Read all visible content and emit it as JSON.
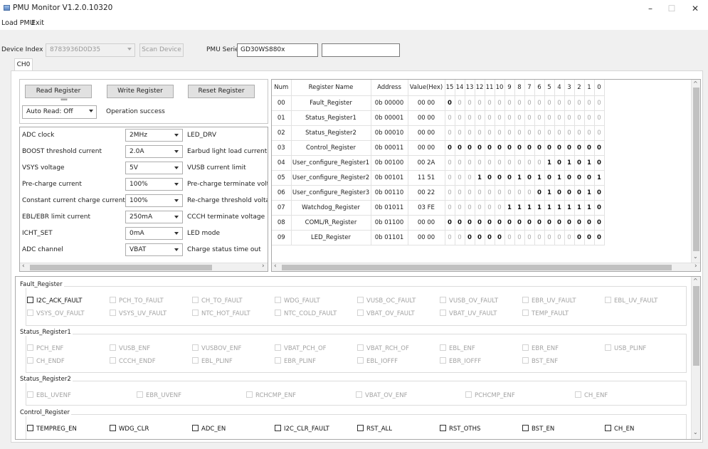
{
  "window": {
    "title": "PMU Monitor V1.2.0.10320",
    "min_glyph": "–",
    "max_glyph": "☐",
    "close_glyph": "✕"
  },
  "menu": [
    "Load PMU",
    "Exit"
  ],
  "toolbar": {
    "device_index_label": "Device Index",
    "device_index_value": "8783936D0D35",
    "scan_device": "Scan Device",
    "pmu_series_label": "PMU Series",
    "pmu_series_value": "GD30WS880x",
    "extra_value": ""
  },
  "tab": "CH0",
  "controls": {
    "read_register": "Read Register",
    "write_register": "Write Register",
    "reset_register": "Reset Register",
    "indicator": "***",
    "auto_read": "Auto Read: Off",
    "status": "Operation success"
  },
  "params": [
    {
      "name": "ADC clock",
      "value": "2MHz",
      "right": "LED_DRV"
    },
    {
      "name": "BOOST threshold current",
      "value": "2.0A",
      "right": "Earbud light load current"
    },
    {
      "name": "VSYS voltage",
      "value": "5V",
      "right": "VUSB current limit"
    },
    {
      "name": "Pre-charge current",
      "value": "100%",
      "right": "Pre-charge terminate volta"
    },
    {
      "name": "Constant current charge current",
      "value": "100%",
      "right": "Re-charge threshold voltag"
    },
    {
      "name": "EBL/EBR limit current",
      "value": "250mA",
      "right": "CCCH terminate voltage"
    },
    {
      "name": "ICHT_SET",
      "value": "0mA",
      "right": "LED mode"
    },
    {
      "name": "ADC channel",
      "value": "VBAT",
      "right": "Charge status time out"
    }
  ],
  "scroll_glyphs": {
    "left": "‹",
    "right": "›",
    "up": "^",
    "down": "⌄"
  },
  "table": {
    "headers": [
      "Num",
      "Register Name",
      "Address",
      "Value(Hex)",
      "15",
      "14",
      "13",
      "12",
      "11",
      "10",
      "9",
      "8",
      "7",
      "6",
      "5",
      "4",
      "3",
      "2",
      "1",
      "0"
    ],
    "rows": [
      {
        "num": "00",
        "name": "Fault_Register",
        "addr": "0b 00000",
        "hex": "00 00",
        "bits": [
          "0",
          "0",
          "0",
          "0",
          "0",
          "0",
          "0",
          "0",
          "0",
          "0",
          "0",
          "0",
          "0",
          "0",
          "0",
          "0"
        ],
        "strong": [
          0
        ]
      },
      {
        "num": "01",
        "name": "Status_Register1",
        "addr": "0b 00001",
        "hex": "00 00",
        "bits": [
          "0",
          "0",
          "0",
          "0",
          "0",
          "0",
          "0",
          "0",
          "0",
          "0",
          "0",
          "0",
          "0",
          "0",
          "0",
          "0"
        ],
        "strong": []
      },
      {
        "num": "02",
        "name": "Status_Register2",
        "addr": "0b 00010",
        "hex": "00 00",
        "bits": [
          "0",
          "0",
          "0",
          "0",
          "0",
          "0",
          "0",
          "0",
          "0",
          "0",
          "0",
          "0",
          "0",
          "0",
          "0",
          "0"
        ],
        "strong": []
      },
      {
        "num": "03",
        "name": "Control_Register",
        "addr": "0b 00011",
        "hex": "00 00",
        "bits": [
          "0",
          "0",
          "0",
          "0",
          "0",
          "0",
          "0",
          "0",
          "0",
          "0",
          "0",
          "0",
          "0",
          "0",
          "0",
          "0"
        ],
        "strong": [
          0,
          1,
          2,
          3,
          4,
          5,
          6,
          7,
          8,
          9,
          10,
          11,
          12,
          13,
          14,
          15
        ]
      },
      {
        "num": "04",
        "name": "User_configure_Register1",
        "addr": "0b 00100",
        "hex": "00 2A",
        "bits": [
          "0",
          "0",
          "0",
          "0",
          "0",
          "0",
          "0",
          "0",
          "0",
          "0",
          "1",
          "0",
          "1",
          "0",
          "1",
          "0"
        ],
        "strong": [
          10,
          11,
          12,
          13,
          14,
          15
        ]
      },
      {
        "num": "05",
        "name": "User_configure_Register2",
        "addr": "0b 00101",
        "hex": "11 51",
        "bits": [
          "0",
          "0",
          "0",
          "1",
          "0",
          "0",
          "0",
          "1",
          "0",
          "1",
          "0",
          "1",
          "0",
          "0",
          "0",
          "1"
        ],
        "strong": [
          3,
          4,
          5,
          6,
          7,
          8,
          9,
          10,
          11,
          12,
          13,
          14,
          15
        ]
      },
      {
        "num": "06",
        "name": "User_configure_Register3",
        "addr": "0b 00110",
        "hex": "00 22",
        "bits": [
          "0",
          "0",
          "0",
          "0",
          "0",
          "0",
          "0",
          "0",
          "0",
          "0",
          "1",
          "0",
          "0",
          "0",
          "1",
          "0"
        ],
        "strong": [
          9,
          10,
          11,
          12,
          13,
          14,
          15
        ]
      },
      {
        "num": "07",
        "name": "Watchdog_Register",
        "addr": "0b 01011",
        "hex": "03 FE",
        "bits": [
          "0",
          "0",
          "0",
          "0",
          "0",
          "0",
          "1",
          "1",
          "1",
          "1",
          "1",
          "1",
          "1",
          "1",
          "1",
          "0"
        ],
        "strong": [
          6,
          7,
          8,
          9,
          10,
          11,
          12,
          13,
          14,
          15
        ]
      },
      {
        "num": "08",
        "name": "COML/R_Register",
        "addr": "0b 01100",
        "hex": "00 00",
        "bits": [
          "0",
          "0",
          "0",
          "0",
          "0",
          "0",
          "0",
          "0",
          "0",
          "0",
          "0",
          "0",
          "0",
          "0",
          "0",
          "0"
        ],
        "strong": [
          0,
          1,
          2,
          3,
          4,
          5,
          6,
          7,
          8,
          9,
          10,
          11,
          12,
          13,
          14,
          15
        ]
      },
      {
        "num": "09",
        "name": "LED_Register",
        "addr": "0b 01101",
        "hex": "00 00",
        "bits": [
          "0",
          "0",
          "0",
          "0",
          "0",
          "0",
          "0",
          "0",
          "0",
          "0",
          "0",
          "0",
          "0",
          "0",
          "0",
          "0"
        ],
        "strong": [
          2,
          3,
          4,
          5,
          13,
          14,
          15
        ]
      }
    ]
  },
  "fault_panel": {
    "groups": [
      {
        "title": "Fault_Register",
        "rows": [
          [
            {
              "t": "I2C_ACK_FAULT",
              "en": true
            },
            {
              "t": "PCH_TO_FAULT"
            },
            {
              "t": "CH_TO_FAULT"
            },
            {
              "t": "WDG_FAULT"
            },
            {
              "t": "VUSB_OC_FAULT"
            },
            {
              "t": "VUSB_OV_FAULT"
            },
            {
              "t": "EBR_UV_FAULT"
            },
            {
              "t": "EBL_UV_FAULT"
            }
          ],
          [
            {
              "t": "VSYS_OV_FAULT"
            },
            {
              "t": "VSYS_UV_FAULT"
            },
            {
              "t": "NTC_HOT_FAULT"
            },
            {
              "t": "NTC_COLD_FAULT"
            },
            {
              "t": "VBAT_OV_FAULT"
            },
            {
              "t": "VBAT_UV_FAULT"
            },
            {
              "t": "TEMP_FAULT"
            }
          ]
        ]
      },
      {
        "title": "Status_Register1",
        "rows": [
          [
            {
              "t": "PCH_ENF"
            },
            {
              "t": "VUSB_ENF"
            },
            {
              "t": "VUSBOV_ENF"
            },
            {
              "t": "VBAT_PCH_OF"
            },
            {
              "t": "VBAT_RCH_OF"
            },
            {
              "t": "EBL_ENF"
            },
            {
              "t": "EBR_ENF"
            },
            {
              "t": "USB_PLINF"
            }
          ],
          [
            {
              "t": "CH_ENDF"
            },
            {
              "t": "CCCH_ENDF"
            },
            {
              "t": "EBL_PLINF"
            },
            {
              "t": "EBR_PLINF"
            },
            {
              "t": "EBL_IOFFF"
            },
            {
              "t": "EBR_IOFFF"
            },
            {
              "t": "BST_ENF"
            }
          ]
        ]
      },
      {
        "title": "Status_Register2",
        "rows": [
          [
            {
              "t": "EBL_UVENF"
            },
            {
              "t": "EBR_UVENF"
            },
            {
              "t": "RCHCMP_ENF"
            },
            {
              "t": "VBAT_OV_ENF"
            },
            {
              "t": "PCHCMP_ENF"
            },
            {
              "t": "CH_ENF"
            }
          ]
        ]
      },
      {
        "title": "Control_Register",
        "rows": [
          [
            {
              "t": "TEMPREG_EN",
              "en": true
            },
            {
              "t": "WDG_CLR",
              "en": true
            },
            {
              "t": "ADC_EN",
              "en": true
            },
            {
              "t": "I2C_CLR_FAULT",
              "en": true
            },
            {
              "t": "RST_ALL",
              "en": true
            },
            {
              "t": "RST_OTHS",
              "en": true
            },
            {
              "t": "BST_EN",
              "en": true
            },
            {
              "t": "CH_EN",
              "en": true
            }
          ]
        ]
      }
    ]
  }
}
